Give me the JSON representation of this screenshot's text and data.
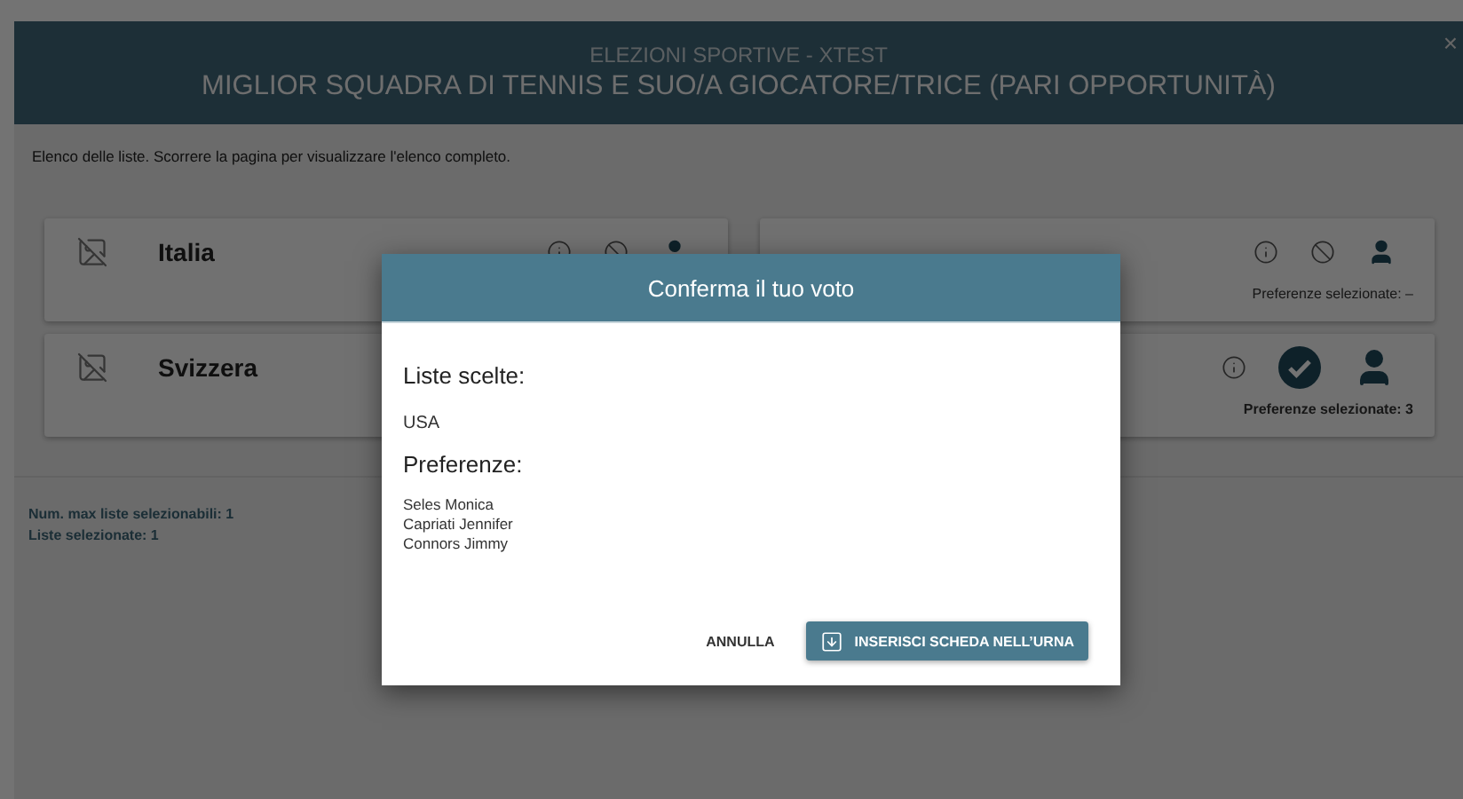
{
  "header": {
    "subtitle": "ELEZIONI SPORTIVE - XTEST",
    "title": "MIGLIOR SQUADRA DI TENNIS E SUO/A GIOCATORE/TRICE (PARI OPPORTUNITÀ)",
    "close": "×"
  },
  "instructions": "Elenco delle liste. Scorrere la pagina per visualizzare l'elenco completo.",
  "lists": [
    {
      "name": "Italia",
      "selected": false
    },
    {
      "selected": false,
      "preferences": "Preferenze selezionate: –"
    },
    {
      "name": "Svizzera",
      "selected": false
    },
    {
      "selected": true,
      "preferences": "Preferenze selezionate: 3"
    }
  ],
  "summary": [
    "Num. max liste selezionabili: 1",
    "Liste selezionate: 1"
  ],
  "dialog": {
    "title": "Conferma il tuo voto",
    "lists_heading": "Liste scelte:",
    "lists": [
      "USA"
    ],
    "preferences_heading": "Preferenze:",
    "preferences": [
      "Seles Monica",
      "Capriati Jennifer",
      "Connors Jimmy"
    ],
    "buttons": [
      {
        "kind": "text",
        "label": "ANNULLA"
      },
      {
        "kind": "primary",
        "label": "INSERISCI SCHEDA NELL’URNA"
      }
    ]
  }
}
